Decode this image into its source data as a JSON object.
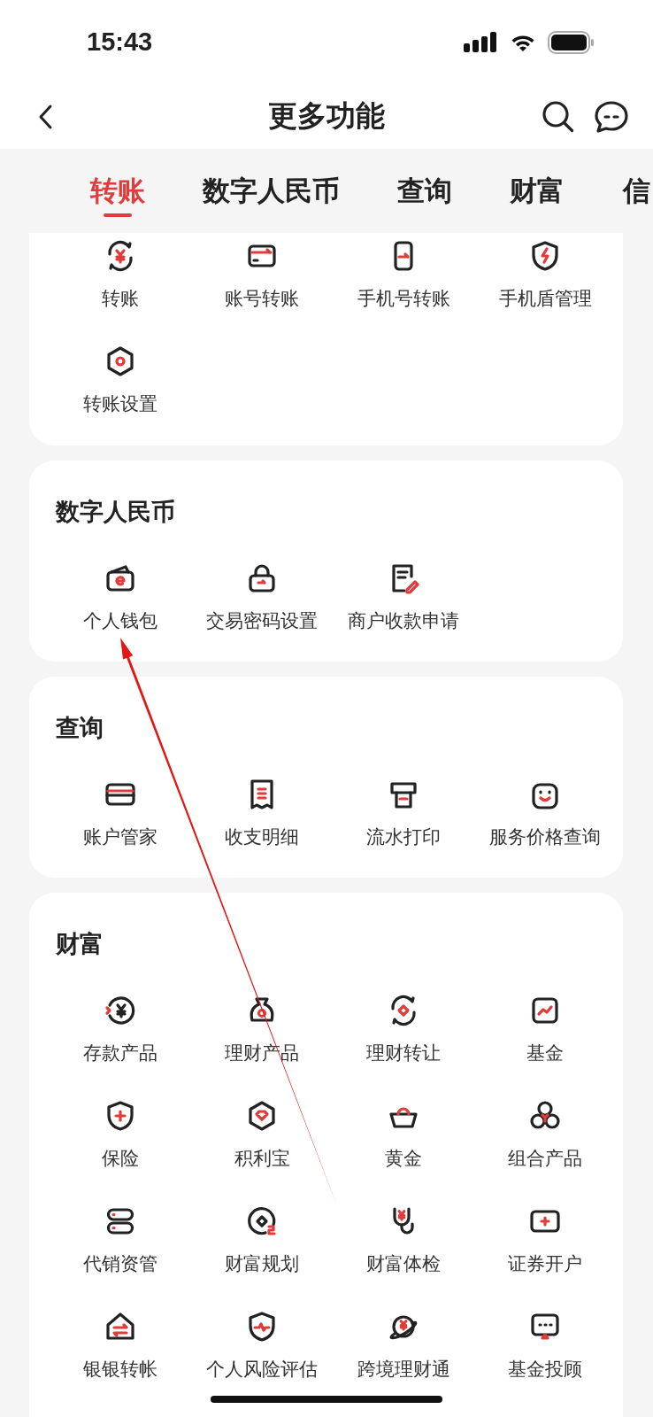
{
  "status_bar": {
    "time": "15:43"
  },
  "header": {
    "title": "更多功能"
  },
  "tabs": [
    {
      "label": "转账",
      "selected": true
    },
    {
      "label": "数字人民币",
      "selected": false
    },
    {
      "label": "查询",
      "selected": false
    },
    {
      "label": "财富",
      "selected": false
    },
    {
      "label": "信",
      "selected": false
    }
  ],
  "sections": [
    {
      "items": [
        "转账",
        "账号转账",
        "手机号转账",
        "手机盾管理",
        "转账设置"
      ]
    },
    {
      "title": "数字人民币",
      "items": [
        "个人钱包",
        "交易密码设置",
        "商户收款申请"
      ]
    },
    {
      "title": "查询",
      "items": [
        "账户管家",
        "收支明细",
        "流水打印",
        "服务价格查询"
      ]
    },
    {
      "title": "财富",
      "items": [
        "存款产品",
        "理财产品",
        "理财转让",
        "基金",
        "保险",
        "积利宝",
        "黄金",
        "组合产品",
        "代销资管",
        "财富规划",
        "财富体检",
        "证券开户",
        "银银转帐",
        "个人风险评估",
        "跨境理财通",
        "基金投顾"
      ]
    }
  ]
}
